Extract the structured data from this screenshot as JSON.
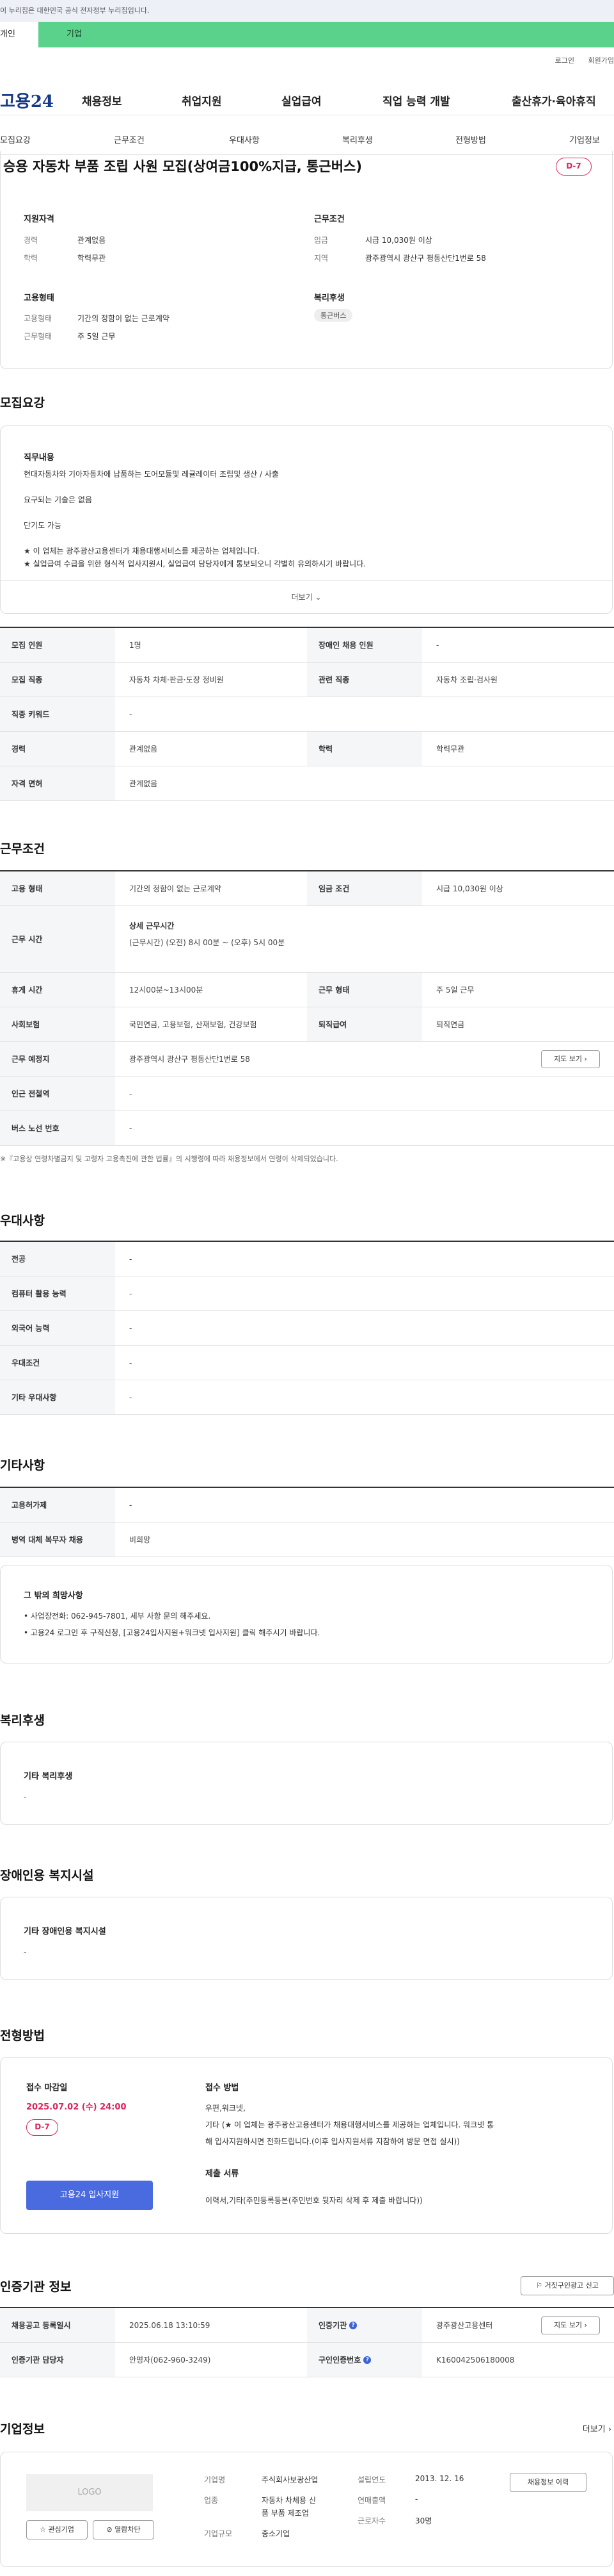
{
  "banner": {
    "text": "이 누리집은 대한민국 공식 전자정부 누리집입니다."
  },
  "top_tabs": {
    "individual": "개인",
    "business": "기업"
  },
  "util": {
    "login": "로그인",
    "join": "회원가입"
  },
  "gnb": {
    "logo": "고용24",
    "items": [
      "채용정보",
      "취업지원",
      "실업급여",
      "직업 능력 개발",
      "출산휴가·육아휴직"
    ]
  },
  "subnav": [
    "모집요강",
    "근무조건",
    "우대사항",
    "복리후생",
    "전형방법",
    "기업정보"
  ],
  "title_card": {
    "title": "승용 자동차 부품 조립 사원 모집(상여금100%지급, 통근버스)",
    "dday": "D-7",
    "qual_title": "지원자격",
    "qual": [
      {
        "label": "경력",
        "value": "관계없음"
      },
      {
        "label": "학력",
        "value": "학력무관"
      }
    ],
    "cond_title": "근무조건",
    "cond": [
      {
        "label": "임금",
        "value": "시급 10,030원 이상"
      },
      {
        "label": "지역",
        "value": "광주광역시 광산구 평동산단1번로 58"
      }
    ],
    "emp_title": "고용형태",
    "emp": [
      {
        "label": "고용형태",
        "value": "기간의 정함이 없는 근로계약"
      },
      {
        "label": "근무형태",
        "value": "주 5일 근무"
      }
    ],
    "welfare_title": "복리후생",
    "welfare_tag": "통근버스"
  },
  "recruit": {
    "heading": "모집요강",
    "duty_title": "직무내용",
    "lines": [
      "현대자동차와 기아자동차에 납품하는 도어모듈및 레귤레이터 조립및 생산 / 사출",
      "요구되는 기술은 없음",
      "단기도 가능",
      "★ 이 업체는 광주광산고용센터가 채용대행서비스를 제공하는 업체입니다.",
      "★ 실업급여 수급을 위한 형식적 입사지원시, 실업급여 담당자에게 통보되오니 각별히 유의하시기 바랍니다."
    ],
    "more": "더보기",
    "rows": [
      [
        {
          "th": "모집 인원",
          "td": "1명"
        },
        {
          "th": "장애인 채용 인원",
          "td": "-"
        }
      ],
      [
        {
          "th": "모집 직종",
          "td": "자동차 차체·판금·도장 정비원"
        },
        {
          "th": "관련 직종",
          "td": "자동차 조립·검사원"
        }
      ],
      [
        {
          "th": "직종 키워드",
          "td": "-"
        }
      ],
      [
        {
          "th": "경력",
          "td": "관계없음"
        },
        {
          "th": "학력",
          "td": "학력무관"
        }
      ],
      [
        {
          "th": "자격 면허",
          "td": "관계없음"
        }
      ]
    ]
  },
  "work": {
    "heading": "근무조건",
    "emp_type_th": "고용 형태",
    "emp_type_td": "기간의 정함이 없는 근로계약",
    "wage_th": "임금 조건",
    "wage_td": "시급 10,030원 이상",
    "time_th": "근무 시간",
    "time_detail_title": "상세 근무시간",
    "time_detail": "(근무시간) (오전) 8시 00분 ~ (오후) 5시 00분",
    "break_th": "휴게 시간",
    "break_td": "12시00분~13시00분",
    "shape_th": "근무 형태",
    "shape_td": "주 5일 근무",
    "ins_th": "사회보험",
    "ins_td": "국민연금, 고용보험, 산재보험, 건강보험",
    "retire_th": "퇴직급여",
    "retire_td": "퇴직연금",
    "place_th": "근무 예정지",
    "place_td": "광주광역시 광산구 평동산단1번로 58",
    "map_btn": "지도 보기",
    "subway_th": "인근 전철역",
    "subway_td": "-",
    "bus_th": "버스 노선 번호",
    "bus_td": "-",
    "note": "※『고용상 연령차별금지 및 고령자 고용촉진에 관한 법률』의 시행령에 따라 채용정보에서 연령이 삭제되었습니다."
  },
  "pref": {
    "heading": "우대사항",
    "rows": [
      {
        "th": "전공",
        "td": "-"
      },
      {
        "th": "컴퓨터 활용 능력",
        "td": "-"
      },
      {
        "th": "외국어 능력",
        "td": "-"
      },
      {
        "th": "우대조건",
        "td": "-"
      },
      {
        "th": "기타 우대사항",
        "td": "-"
      }
    ]
  },
  "etc": {
    "heading": "기타사항",
    "rows": [
      {
        "th": "고용허가제",
        "td": "-"
      },
      {
        "th": "병역 대체 복무자 채용",
        "td": "비희망"
      }
    ],
    "box_title": "그 밖의 희망사항",
    "box_lines": [
      "• 사업장전화: 062-945-7801, 세부 사항 문의 해주세요.",
      "• 고용24 로그인 후 구직신청, [고용24입사지원+워크넷 입사지원] 클릭 해주시기 바랍니다."
    ]
  },
  "welfare": {
    "heading": "복리후생",
    "title": "기타 복리후생",
    "value": "-"
  },
  "disabled": {
    "heading": "장애인용 복지시설",
    "title": "기타 장애인용 복지시설",
    "value": "-"
  },
  "screening": {
    "heading": "전형방법",
    "deadline_title": "접수 마감일",
    "deadline": "2025.07.02 (수) 24:00",
    "dday": "D-7",
    "apply_btn": "고용24 입사지원",
    "method_title": "접수 방법",
    "method_line1": "우편,워크넷,",
    "method_line2": "기타 (★ 이 업체는 광주광산고용센터가 채용대행서비스를 제공하는 업체입니다. 워크넷 통",
    "method_line3": "해 입사지원하시면 전화드립니다.(이후 입사지원서류 지참하여 방문 면접 실시))",
    "docs_title": "제출 서류",
    "docs": "이력서,기타(주민등록등본(주민번호 뒷자리 삭제 후 제출 바랍니다))"
  },
  "cert": {
    "heading": "인증기관 정보",
    "report_btn": "거짓구인광고 신고",
    "reg_th": "채용공고 등록일시",
    "reg_td": "2025.06.18 13:10:59",
    "org_th": "인증기관",
    "org_td": "광주광산고용센터",
    "map_btn": "지도 보기",
    "mgr_th": "인증기관 담당자",
    "mgr_td": "안명자(062-960-3249)",
    "num_th": "구인인증번호",
    "num_td": "K160042506180008"
  },
  "company": {
    "heading": "기업정보",
    "more": "더보기",
    "logo": "LOGO",
    "fav_btn": "관심기업",
    "block_btn": "열람차단",
    "name_label": "기업명",
    "name": "주식회사보광산업",
    "industry_label": "업종",
    "industry_l1": "자동차 차체용 신",
    "industry_l2": "품 부품 제조업",
    "size_label": "기업규모",
    "size": "중소기업",
    "est_label": "설립연도",
    "est": "2013. 12. 16",
    "sales_label": "연매출액",
    "sales": "-",
    "emp_label": "근로자수",
    "emp": "30명",
    "history_btn": "채용정보 이력"
  }
}
